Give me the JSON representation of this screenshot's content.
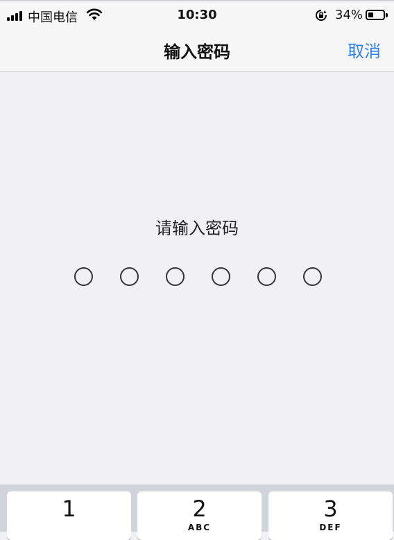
{
  "status": {
    "carrier": "中国电信",
    "time": "10:30",
    "battery_percent_label": "34%",
    "battery_level": 0.34
  },
  "nav": {
    "title": "输入密码",
    "cancel_label": "取消"
  },
  "prompt": "请输入密码",
  "pin": {
    "length": 6,
    "filled": 0
  },
  "keys": [
    {
      "num": "1",
      "letters": ""
    },
    {
      "num": "2",
      "letters": "ABC"
    },
    {
      "num": "3",
      "letters": "DEF"
    }
  ],
  "colors": {
    "accent": "#2f80ed",
    "background": "#f1f0f5",
    "keypad": "#d1d4da"
  }
}
